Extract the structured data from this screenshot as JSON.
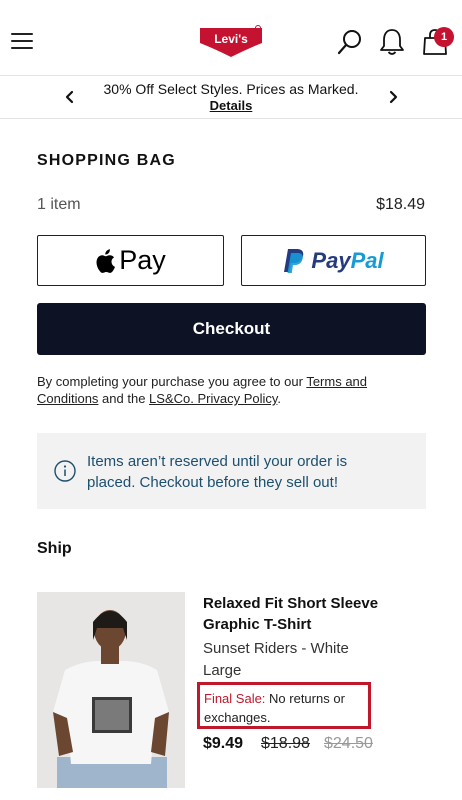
{
  "header": {
    "brand": "Levi's",
    "cart_count": "1"
  },
  "promo": {
    "text": "30% Off Select Styles. Prices as Marked.",
    "link": "Details"
  },
  "bag": {
    "title": "SHOPPING BAG",
    "item_count": "1 item",
    "total": "$18.49"
  },
  "payments": {
    "apple_pay": "Pay",
    "paypal_part1": "Pay",
    "paypal_part2": "Pal"
  },
  "checkout_label": "Checkout",
  "terms": {
    "prefix": "By completing your purchase you agree to our ",
    "terms_link": "Terms and Conditions",
    "middle": " and the ",
    "privacy_link": "LS&Co. Privacy Policy",
    "suffix": "."
  },
  "notice": "Items aren’t reserved until your order is placed. Checkout before they sell out!",
  "ship_label": "Ship",
  "product": {
    "name": "Relaxed Fit Short Sleeve Graphic T-Shirt",
    "color": "Sunset Riders - White",
    "size": "Large",
    "final_sale_label": "Final Sale:",
    "final_sale_text": " No returns or exchanges.",
    "price_now": "$9.49",
    "price_was": "$18.98",
    "price_orig": "$24.50"
  },
  "colors": {
    "brand_red": "#c41230",
    "checkout_bg": "#0d1225",
    "notice_text": "#1d4f6e",
    "paypal_dark": "#253b80",
    "paypal_light": "#179bd7"
  }
}
